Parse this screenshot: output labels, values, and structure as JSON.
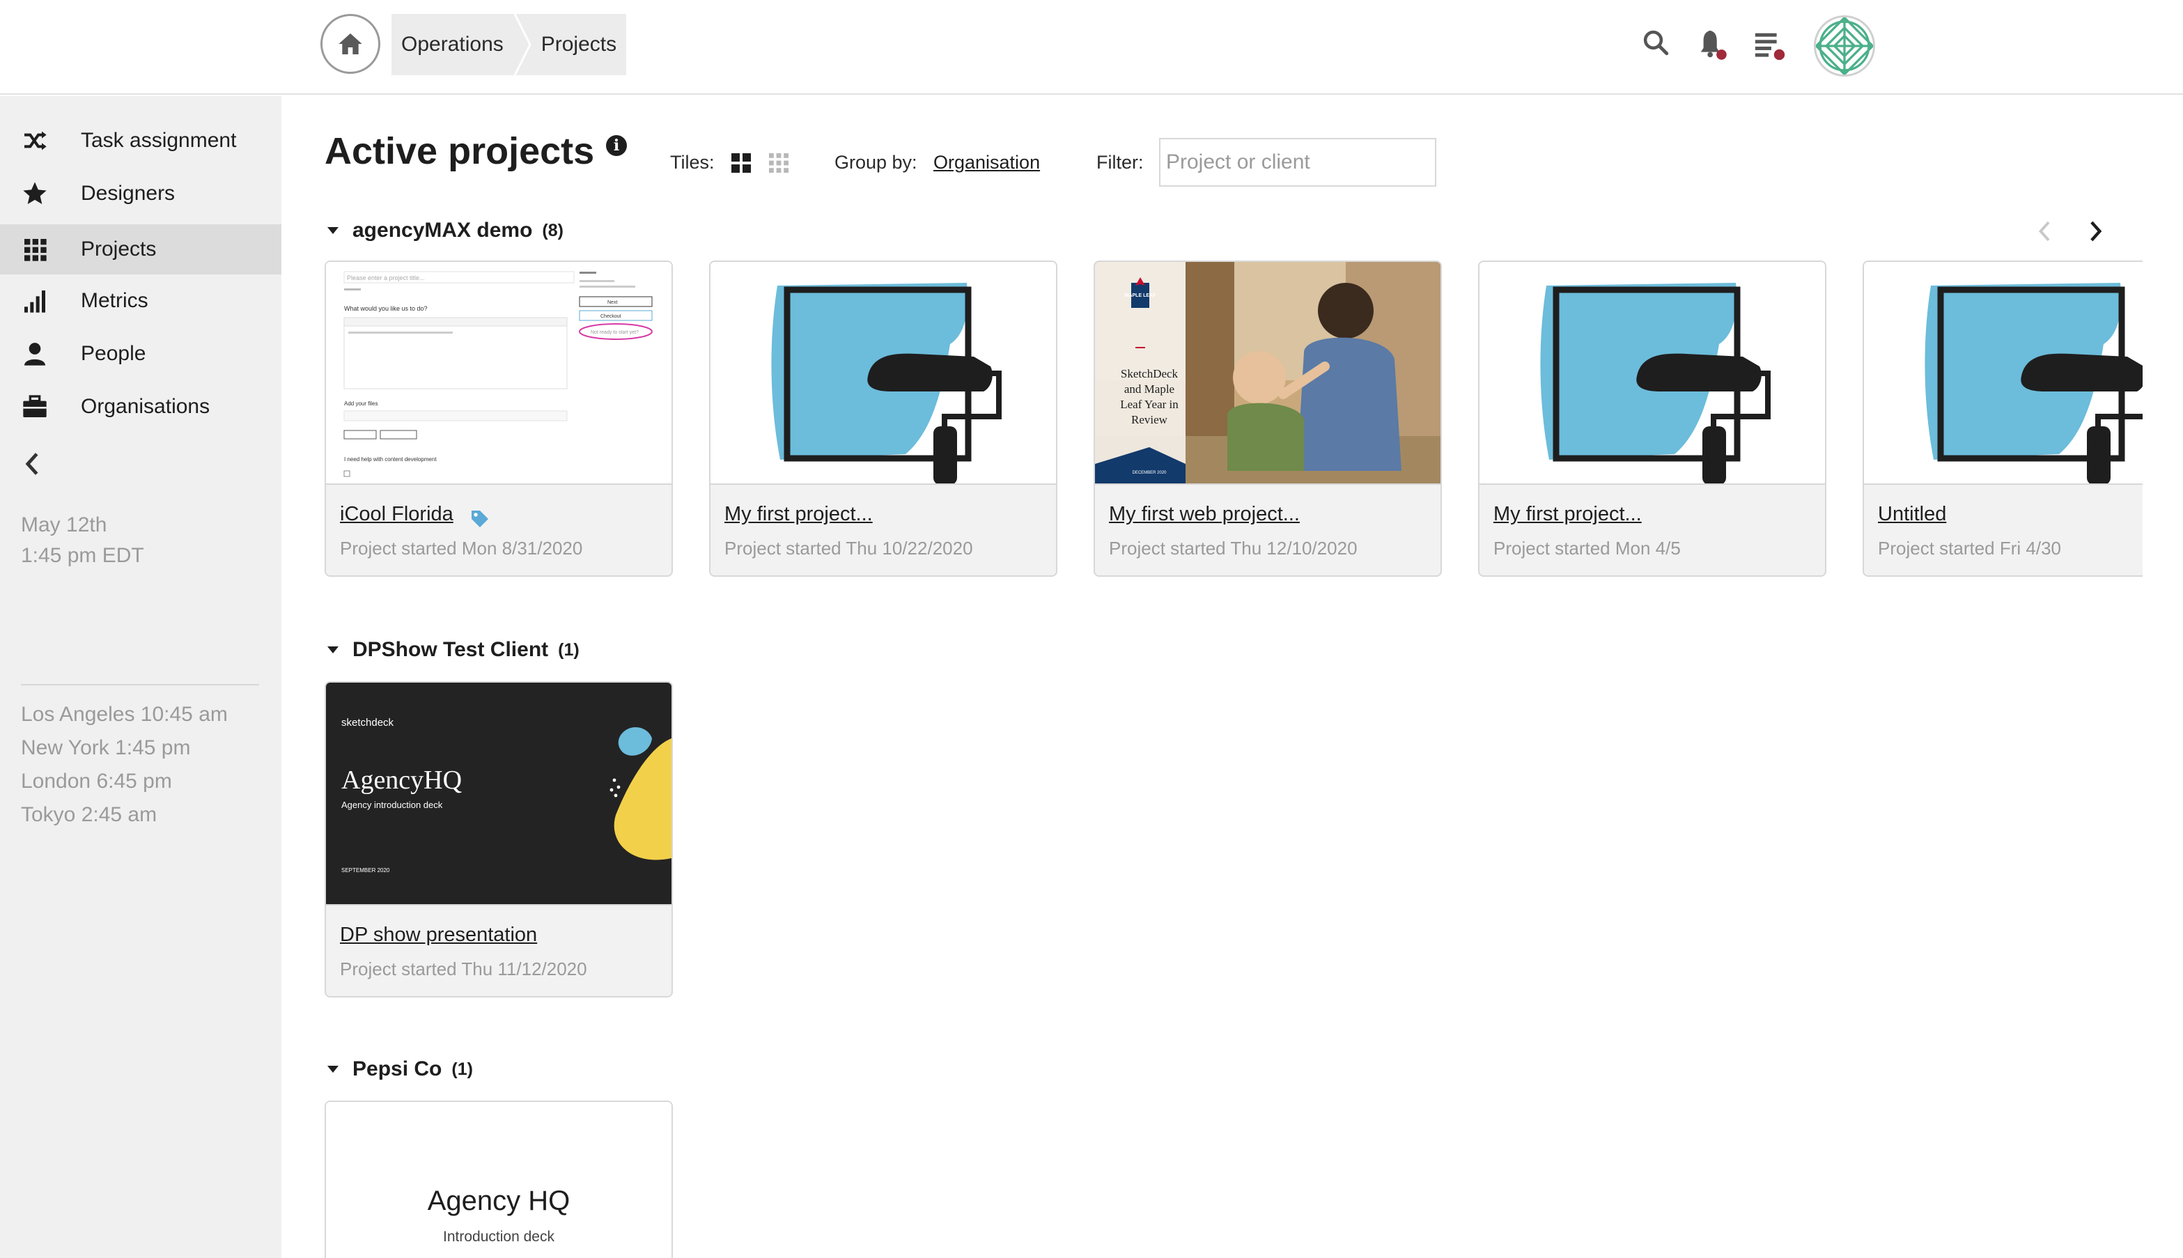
{
  "header": {
    "breadcrumbs": [
      "Operations",
      "Projects"
    ],
    "icons": [
      "home-icon",
      "search-icon",
      "bell-icon",
      "list-icon",
      "avatar"
    ],
    "notification_color": "#a02a3a"
  },
  "sidebar": {
    "items": [
      {
        "label": "Task assignment",
        "icon": "shuffle-icon"
      },
      {
        "label": "Designers",
        "icon": "star-icon"
      },
      {
        "label": "Projects",
        "icon": "grid-icon",
        "active": true
      },
      {
        "label": "Metrics",
        "icon": "bar-chart-icon"
      },
      {
        "label": "People",
        "icon": "person-icon"
      },
      {
        "label": "Organisations",
        "icon": "briefcase-icon"
      }
    ],
    "date": "May 12th",
    "time": "1:45 pm EDT",
    "world_clocks": [
      "Los Angeles 10:45 am",
      "New York 1:45 pm",
      "London 6:45 pm",
      "Tokyo 2:45 am"
    ]
  },
  "main": {
    "title": "Active projects",
    "tiles_label": "Tiles:",
    "group_by_label": "Group by:",
    "group_by_value": "Organisation",
    "filter_label": "Filter:",
    "filter_placeholder": "Project or client",
    "groups": [
      {
        "name": "agencyMAX demo",
        "count": "(8)",
        "projects": [
          {
            "title": "iCool Florida",
            "started": "Project started Mon 8/31/2020",
            "thumb": "form-screenshot",
            "tagged": true
          },
          {
            "title": "My first project...",
            "started": "Project started Thu 10/22/2020",
            "thumb": "paint-roller"
          },
          {
            "title": "My first web project...",
            "started": "Project started Thu 12/10/2020",
            "thumb": "photo-mother-child"
          },
          {
            "title": "My first project...",
            "started": "Project started Mon 4/5",
            "thumb": "paint-roller"
          },
          {
            "title": "Untitled",
            "started": "Project started Fri 4/30",
            "thumb": "paint-roller"
          }
        ]
      },
      {
        "name": "DPShow Test Client",
        "count": "(1)",
        "projects": [
          {
            "title": "DP show presentation",
            "started": "Project started Thu 11/12/2020",
            "thumb": "dark-deck"
          }
        ]
      },
      {
        "name": "Pepsi Co",
        "count": "(1)",
        "projects": [
          {
            "title": "",
            "started": "",
            "thumb": "white-deck"
          }
        ]
      }
    ],
    "thumbs": {
      "maple": {
        "brand": "MAPLE LEAF",
        "lines": [
          "SketchDeck",
          "and Maple",
          "Leaf Year in",
          "Review"
        ],
        "footer": "DECEMBER 2020"
      },
      "dark": {
        "brand": "sketchdeck",
        "title": "AgencyHQ",
        "subtitle": "Agency introduction deck",
        "date": "SEPTEMBER 2020"
      },
      "white": {
        "title": "Agency HQ",
        "subtitle": "Introduction deck"
      },
      "form": {
        "placeholder": "Please enter a project title...",
        "q1": "What would you like us to do?",
        "q2": "Add your files",
        "q3": "I need help with content development",
        "button": "Next",
        "checkout": "Checkout",
        "link": "Not ready to start yet?"
      }
    },
    "colors": {
      "accent_blue": "#6cbcdb",
      "dark": "#1e1e1e",
      "tag_blue": "#5aa9d6"
    }
  }
}
